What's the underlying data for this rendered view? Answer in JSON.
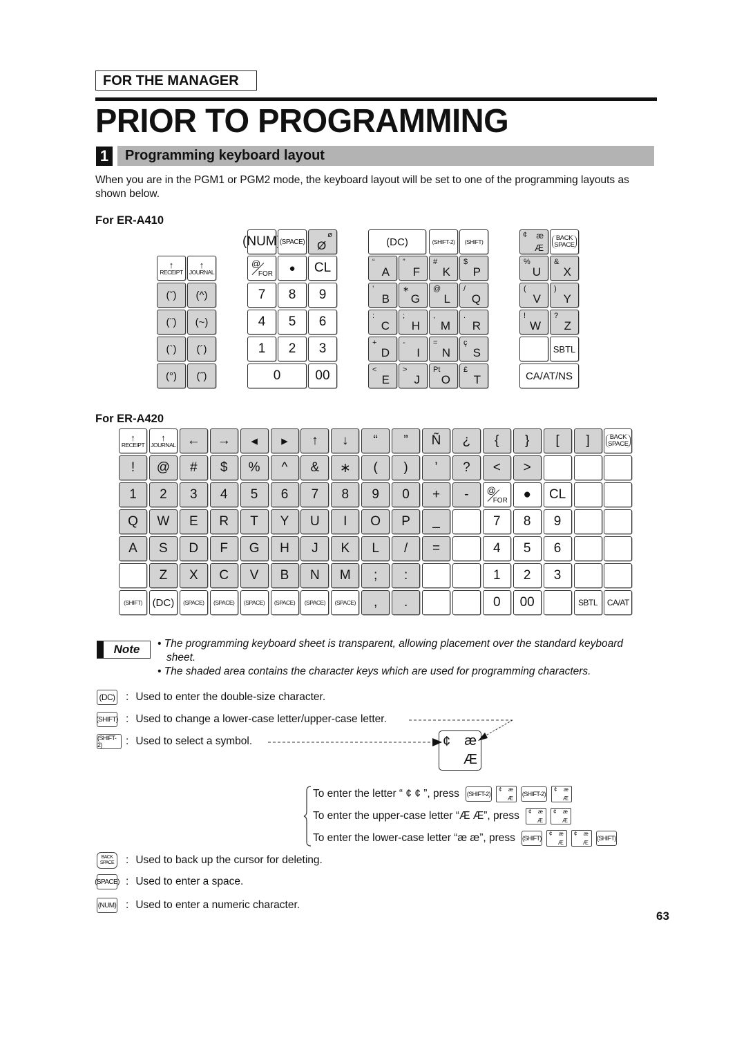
{
  "header": {
    "section_tag": "FOR THE MANAGER",
    "title": "PRIOR TO PROGRAMMING"
  },
  "section": {
    "number": "1",
    "heading": "Programming keyboard layout",
    "intro": "When you are in the PGM1 or PGM2 mode, the keyboard layout will be set to one of the programming layouts as shown below."
  },
  "er_a410": {
    "label": "For ER-A410",
    "left_keys": {
      "receipt": "RECEIPT",
      "journal": "JOURNAL",
      "accents": [
        "(ˇ)",
        "(^)",
        "(¨)",
        "(~)",
        "(`)",
        "(´)",
        "(°)",
        "(˝)"
      ]
    },
    "numpad": {
      "num": "(NUM)",
      "space": "(SPACE)",
      "slash_o_small": "ø",
      "slash_o_big": "Ø",
      "at": "@",
      "for": "FOR",
      "dot": "●",
      "cl": "CL",
      "digits": [
        "7",
        "8",
        "9",
        "4",
        "5",
        "6",
        "1",
        "2",
        "3"
      ],
      "zero": "0",
      "double_zero": "00"
    },
    "char_block": {
      "dc": "(DC)",
      "shift2": "(SHIFT-2)",
      "shift": "(SHIFT)",
      "keys": [
        {
          "sym": "“",
          "ch": "A"
        },
        {
          "sym": "”",
          "ch": "F"
        },
        {
          "sym": "#",
          "ch": "K"
        },
        {
          "sym": "$",
          "ch": "P"
        },
        {
          "sym": "’",
          "ch": "B"
        },
        {
          "sym": "∗",
          "ch": "G"
        },
        {
          "sym": "@",
          "ch": "L"
        },
        {
          "sym": "/",
          "ch": "Q"
        },
        {
          "sym": ":",
          "ch": "C"
        },
        {
          "sym": ";",
          "ch": "H"
        },
        {
          "sym": ",",
          "ch": "M"
        },
        {
          "sym": ".",
          "ch": "R"
        },
        {
          "sym": "+",
          "ch": "D"
        },
        {
          "sym": "-",
          "ch": "I"
        },
        {
          "sym": "=",
          "ch": "N"
        },
        {
          "sym": "ç",
          "ch": "S"
        },
        {
          "sym": "<",
          "ch": "E"
        },
        {
          "sym": ">",
          "ch": "J"
        },
        {
          "sym": "Pt",
          "ch": "O"
        },
        {
          "sym": "£",
          "ch": "T"
        }
      ]
    },
    "right_block": {
      "cae": {
        "c": "¢",
        "ae": "æ",
        "AE": "Æ"
      },
      "back": "BACK",
      "space": "SPACE",
      "keys": [
        {
          "sym": "%",
          "ch": "U"
        },
        {
          "sym": "&",
          "ch": "X"
        },
        {
          "sym": "(",
          "ch": "V"
        },
        {
          "sym": ")",
          "ch": "Y"
        },
        {
          "sym": "!",
          "ch": "W"
        },
        {
          "sym": "?",
          "ch": "Z"
        }
      ],
      "sbtl": "SBTL",
      "ca_at_ns": "CA/AT/NS"
    }
  },
  "er_a420": {
    "label": "For ER-A420",
    "rows": [
      [
        {
          "t": "receipt",
          "l": "RECEIPT",
          "s": 0
        },
        {
          "t": "journal",
          "l": "JOURNAL",
          "s": 0
        },
        {
          "l": "←",
          "s": 1
        },
        {
          "l": "→",
          "s": 1
        },
        {
          "l": "◂",
          "s": 1
        },
        {
          "l": "▸",
          "s": 1
        },
        {
          "l": "↑",
          "s": 1
        },
        {
          "l": "↓",
          "s": 1
        },
        {
          "l": "“",
          "s": 1
        },
        {
          "l": "”",
          "s": 1
        },
        {
          "l": "Ñ",
          "s": 1
        },
        {
          "l": "¿",
          "s": 1
        },
        {
          "l": "{",
          "s": 1
        },
        {
          "l": "}",
          "s": 1
        },
        {
          "l": "[",
          "s": 1
        },
        {
          "l": "]",
          "s": 1
        },
        {
          "t": "bsp",
          "l": "BACK SPACE",
          "s": 0
        }
      ],
      [
        {
          "l": "!",
          "s": 1
        },
        {
          "l": "@",
          "s": 1
        },
        {
          "l": "#",
          "s": 1
        },
        {
          "l": "$",
          "s": 1
        },
        {
          "l": "%",
          "s": 1
        },
        {
          "l": "^",
          "s": 1
        },
        {
          "l": "&",
          "s": 1
        },
        {
          "l": "∗",
          "s": 1
        },
        {
          "l": "(",
          "s": 1
        },
        {
          "l": ")",
          "s": 1
        },
        {
          "l": "’",
          "s": 1
        },
        {
          "l": "?",
          "s": 1
        },
        {
          "l": "<",
          "s": 1
        },
        {
          "l": ">",
          "s": 1
        },
        {
          "l": "",
          "s": 0
        },
        {
          "l": "",
          "s": 0
        },
        {
          "l": "",
          "s": 0
        }
      ],
      [
        {
          "l": "1",
          "s": 1
        },
        {
          "l": "2",
          "s": 1
        },
        {
          "l": "3",
          "s": 1
        },
        {
          "l": "4",
          "s": 1
        },
        {
          "l": "5",
          "s": 1
        },
        {
          "l": "6",
          "s": 1
        },
        {
          "l": "7",
          "s": 1
        },
        {
          "l": "8",
          "s": 1
        },
        {
          "l": "9",
          "s": 1
        },
        {
          "l": "0",
          "s": 1
        },
        {
          "l": "+",
          "s": 1
        },
        {
          "l": "-",
          "s": 1
        },
        {
          "t": "for",
          "l": "@/FOR",
          "s": 0
        },
        {
          "l": "●",
          "s": 0
        },
        {
          "l": "CL",
          "s": 0
        },
        {
          "l": "",
          "s": 0
        },
        {
          "l": "",
          "s": 0
        }
      ],
      [
        {
          "l": "Q",
          "s": 1
        },
        {
          "l": "W",
          "s": 1
        },
        {
          "l": "E",
          "s": 1
        },
        {
          "l": "R",
          "s": 1
        },
        {
          "l": "T",
          "s": 1
        },
        {
          "l": "Y",
          "s": 1
        },
        {
          "l": "U",
          "s": 1
        },
        {
          "l": "I",
          "s": 1
        },
        {
          "l": "O",
          "s": 1
        },
        {
          "l": "P",
          "s": 1
        },
        {
          "l": "_",
          "s": 1
        },
        {
          "l": "",
          "s": 0
        },
        {
          "l": "7",
          "s": 0
        },
        {
          "l": "8",
          "s": 0
        },
        {
          "l": "9",
          "s": 0
        },
        {
          "l": "",
          "s": 0
        },
        {
          "l": "",
          "s": 0
        }
      ],
      [
        {
          "l": "A",
          "s": 1
        },
        {
          "l": "S",
          "s": 1
        },
        {
          "l": "D",
          "s": 1
        },
        {
          "l": "F",
          "s": 1
        },
        {
          "l": "G",
          "s": 1
        },
        {
          "l": "H",
          "s": 1
        },
        {
          "l": "J",
          "s": 1
        },
        {
          "l": "K",
          "s": 1
        },
        {
          "l": "L",
          "s": 1
        },
        {
          "l": "/",
          "s": 1
        },
        {
          "l": "=",
          "s": 1
        },
        {
          "l": "",
          "s": 0
        },
        {
          "l": "4",
          "s": 0
        },
        {
          "l": "5",
          "s": 0
        },
        {
          "l": "6",
          "s": 0
        },
        {
          "l": "",
          "s": 0
        },
        {
          "l": "",
          "s": 0
        }
      ],
      [
        {
          "l": "",
          "s": 0
        },
        {
          "l": "Z",
          "s": 1
        },
        {
          "l": "X",
          "s": 1
        },
        {
          "l": "C",
          "s": 1
        },
        {
          "l": "V",
          "s": 1
        },
        {
          "l": "B",
          "s": 1
        },
        {
          "l": "N",
          "s": 1
        },
        {
          "l": "M",
          "s": 1
        },
        {
          "l": ";",
          "s": 1
        },
        {
          "l": ":",
          "s": 1
        },
        {
          "l": "",
          "s": 0
        },
        {
          "l": "",
          "s": 0
        },
        {
          "l": "1",
          "s": 0
        },
        {
          "l": "2",
          "s": 0
        },
        {
          "l": "3",
          "s": 0
        },
        {
          "l": "",
          "s": 0
        },
        {
          "l": "",
          "s": 0
        }
      ],
      [
        {
          "t": "small",
          "l": "(SHIFT)",
          "s": 0
        },
        {
          "l": "(DC)",
          "s": 0
        },
        {
          "t": "small",
          "l": "(SPACE)",
          "s": 0
        },
        {
          "t": "small",
          "l": "(SPACE)",
          "s": 0
        },
        {
          "t": "small",
          "l": "(SPACE)",
          "s": 0
        },
        {
          "t": "small",
          "l": "(SPACE)",
          "s": 0
        },
        {
          "t": "small",
          "l": "(SPACE)",
          "s": 0
        },
        {
          "t": "small",
          "l": "(SPACE)",
          "s": 0
        },
        {
          "l": ",",
          "s": 1
        },
        {
          "l": ".",
          "s": 1
        },
        {
          "l": "",
          "s": 0
        },
        {
          "l": "",
          "s": 0
        },
        {
          "l": "0",
          "s": 0
        },
        {
          "l": "00",
          "s": 0
        },
        {
          "l": "",
          "s": 0
        },
        {
          "t": "small2",
          "l": "SBTL",
          "s": 0
        },
        {
          "t": "small2",
          "l": "CA/AT",
          "s": 0
        }
      ]
    ]
  },
  "note": {
    "badge": "Note",
    "bullets": [
      "• The programming keyboard sheet is transparent, allowing placement over the standard keyboard",
      "sheet.",
      "• The shaded area contains the character keys which are used for programming characters."
    ]
  },
  "descriptions": [
    {
      "key": "(DC)",
      "text": "Used to enter the double-size character."
    },
    {
      "key": "(SHIFT)",
      "text": "Used to change a lower-case letter/upper-case letter."
    },
    {
      "key": "(SHIFT-2)",
      "text": "Used to select a symbol."
    },
    {
      "key": "BACK SPACE",
      "text": "Used to back up the cursor for deleting."
    },
    {
      "key": "(SPACE)",
      "text": "Used to enter a space."
    },
    {
      "key": "(NUM)",
      "text": "Used to enter a numeric character."
    }
  ],
  "callout_key": {
    "c": "¢",
    "ae": "æ",
    "AE": "Æ"
  },
  "examples": [
    {
      "text": "To enter the letter “ ¢ ¢ ”, press",
      "shift2": "(SHIFT-2)"
    },
    {
      "text": "To enter the upper-case letter “Æ Æ”, press"
    },
    {
      "text": "To enter the lower-case letter “æ æ”, press",
      "shift": "(SHIFT)"
    }
  ],
  "colon": ":",
  "page_number": "63"
}
